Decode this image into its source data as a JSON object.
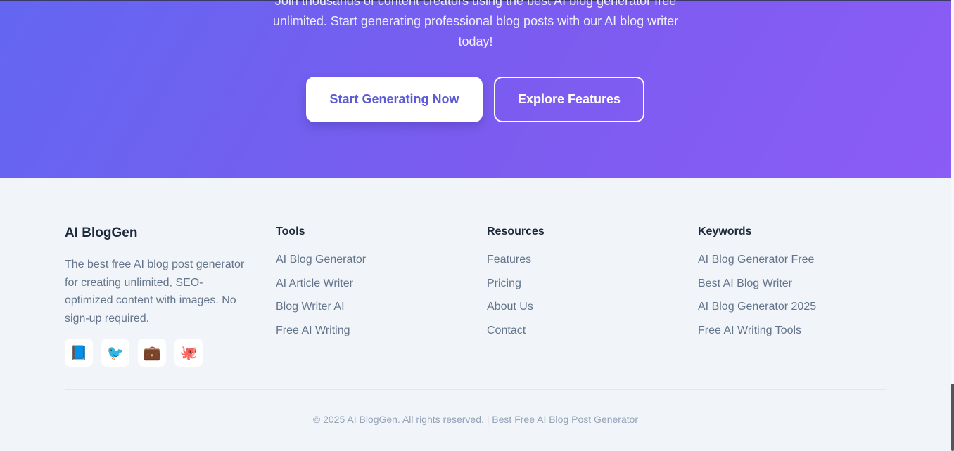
{
  "hero": {
    "text": "Join thousands of content creators using the best AI blog generator free unlimited. Start generating professional blog posts with our AI blog writer today!",
    "primary_button": "Start Generating Now",
    "secondary_button": "Explore Features"
  },
  "footer": {
    "brand": {
      "title": "AI BlogGen",
      "description": "The best free AI blog post generator for creating unlimited, SEO-optimized content with images. No sign-up required."
    },
    "social": [
      {
        "icon": "📘",
        "name": "book-icon"
      },
      {
        "icon": "🐦",
        "name": "bird-icon"
      },
      {
        "icon": "💼",
        "name": "briefcase-icon"
      },
      {
        "icon": "🐙",
        "name": "octopus-icon"
      }
    ],
    "columns": [
      {
        "title": "Tools",
        "links": [
          "AI Blog Generator",
          "AI Article Writer",
          "Blog Writer AI",
          "Free AI Writing"
        ]
      },
      {
        "title": "Resources",
        "links": [
          "Features",
          "Pricing",
          "About Us",
          "Contact"
        ]
      },
      {
        "title": "Keywords",
        "links": [
          "AI Blog Generator Free",
          "Best AI Blog Writer",
          "AI Blog Generator 2025",
          "Free AI Writing Tools"
        ]
      }
    ],
    "copyright": "© 2025 AI BlogGen. All rights reserved. | Best Free AI Blog Post Generator"
  },
  "colors": {
    "gradient_start": "#6366f1",
    "gradient_end": "#8b5cf6",
    "footer_bg": "#f1f5f9"
  }
}
